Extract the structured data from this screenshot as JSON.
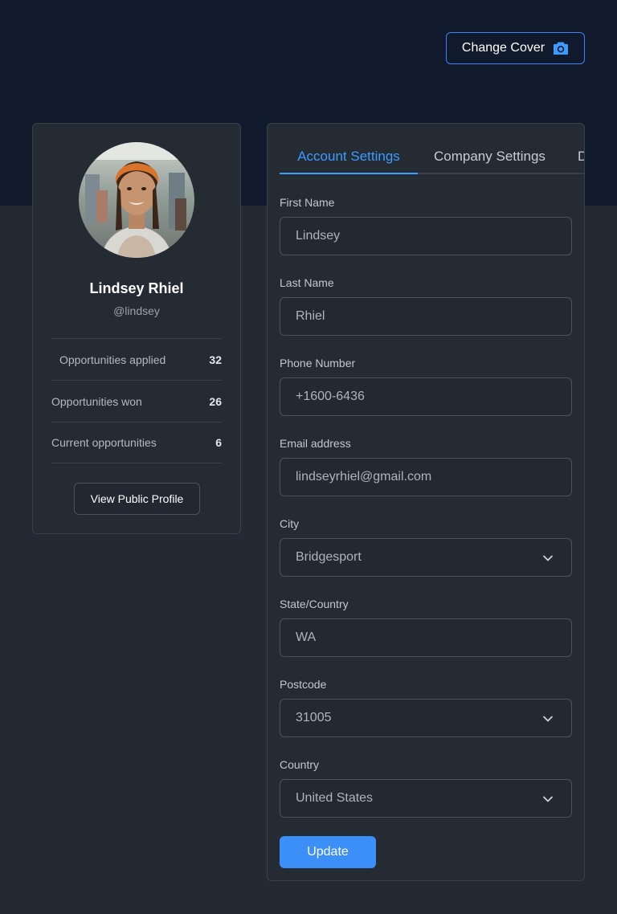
{
  "header": {
    "change_cover_label": "Change Cover",
    "icon": "camera-icon"
  },
  "profile": {
    "avatar": "profile-photo",
    "name": "Lindsey Rhiel",
    "handle": "@lindsey",
    "stats": [
      {
        "label": "Opportunities applied",
        "value": "32"
      },
      {
        "label": "Opportunities won",
        "value": "26"
      },
      {
        "label": "Current opportunities",
        "value": "6"
      }
    ],
    "view_public_profile_label": "View Public Profile"
  },
  "settings": {
    "tabs": [
      {
        "label": "Account Settings",
        "active": true
      },
      {
        "label": "Company Settings",
        "active": false
      },
      {
        "label": "D",
        "active": false
      }
    ],
    "fields": {
      "first_name": {
        "label": "First Name",
        "value": "Lindsey"
      },
      "last_name": {
        "label": "Last Name",
        "value": "Rhiel"
      },
      "phone": {
        "label": "Phone Number",
        "value": "+1600-6436"
      },
      "email": {
        "label": "Email address",
        "value": "lindseyrhiel@gmail.com"
      },
      "city": {
        "label": "City",
        "value": "Bridgesport"
      },
      "state": {
        "label": "State/Country",
        "value": "WA"
      },
      "postcode": {
        "label": "Postcode",
        "value": "31005"
      },
      "country": {
        "label": "Country",
        "value": "United States"
      }
    },
    "update_label": "Update"
  },
  "colors": {
    "cover_bg": "#111a2c",
    "page_bg": "#232a33",
    "accent": "#3b9bff",
    "button_primary": "#3b8ff6"
  }
}
